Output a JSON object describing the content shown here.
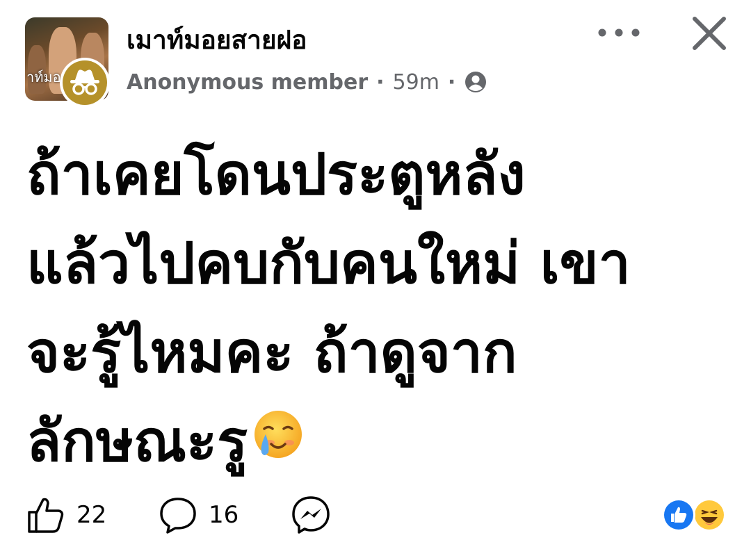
{
  "header": {
    "group_name": "เมาท์มอยสายฝอ",
    "avatar_text": "าท์มอ",
    "author": "Anonymous member",
    "separator": "·",
    "timestamp": "59m",
    "privacy_icon": "group-members-icon",
    "more_icon": "more-dots-icon",
    "close_icon": "close-icon"
  },
  "post": {
    "lines": [
      "ถ้าเคยโดนประตูหลัง",
      "แล้วไปคบกับคนใหม่ เขา",
      "จะรู้ไหมคะ ถ้าดูจาก",
      "ลักษณะรู"
    ],
    "emoji": "smiling-face-with-tear-emoji"
  },
  "actions": {
    "like_count": "22",
    "comment_count": "16",
    "like_icon": "thumbs-up-icon",
    "comment_icon": "comment-bubble-icon",
    "share_icon": "messenger-icon"
  },
  "reactions": [
    "like-reaction-icon",
    "haha-reaction-icon"
  ],
  "colors": {
    "text": "#050505",
    "meta": "#65676b",
    "like_blue": "#1877f2",
    "anon_gold": "#b5912a",
    "emoji_yellow": "#ffc93c"
  }
}
